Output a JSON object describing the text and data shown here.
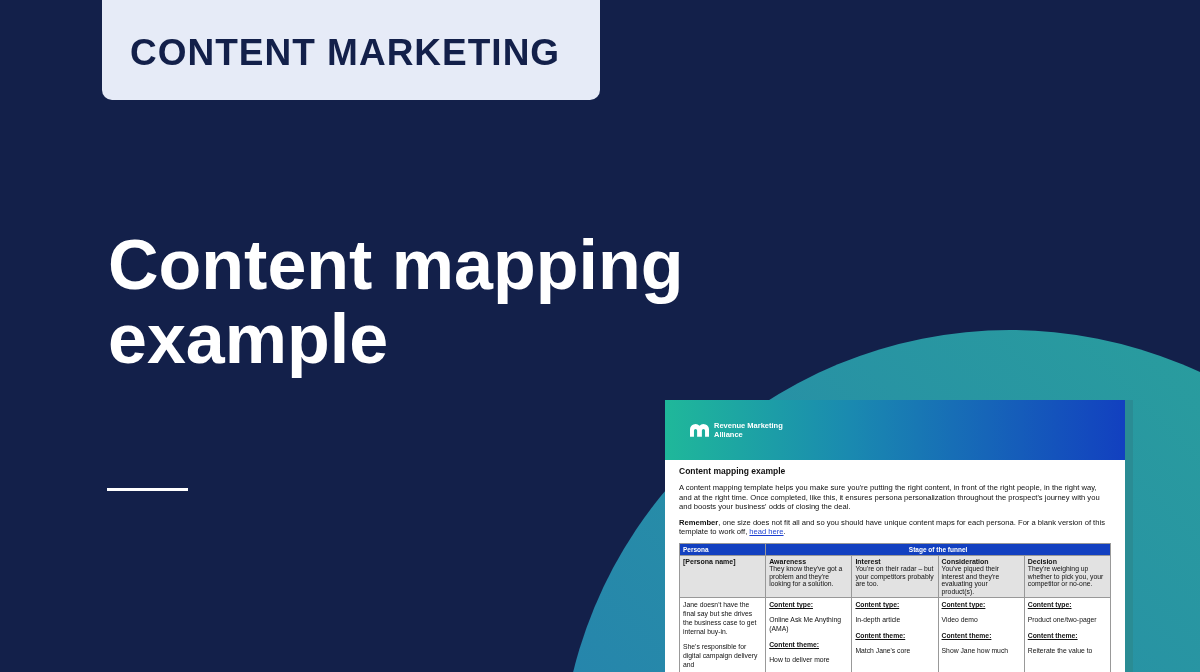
{
  "category": "CONTENT MARKETING",
  "title": "Content mapping example",
  "document": {
    "brand": "Revenue Marketing Alliance",
    "heading": "Content mapping example",
    "intro": "A content mapping template helps you make sure you're putting the right content, in front of the right people, in the right way, and at the right time. Once completed, like this, it ensures persona personalization throughout the prospect's journey with you and boosts your business' odds of closing the deal.",
    "note": "**Remember**, one size does not fit all and so you should have unique content maps for each persona. For a blank version of this template to work off,",
    "note_link": "head here",
    "note_end": ".",
    "table": {
      "persona_header": "Persona",
      "stage_header": "Stage of the funnel",
      "persona_name": "[Persona name]",
      "persona_text": [
        "Jane doesn't have the final say but she drives the business case to get internal buy-in.",
        "She's responsible for digital campaign delivery and"
      ],
      "stages": [
        {
          "name": "Awareness",
          "description": "They know they've got a problem and they're looking for a solution.",
          "type_label": "Content type:",
          "type": "Online Ask Me Anything (AMA)",
          "theme_label": "Content theme:",
          "theme": "How to deliver more"
        },
        {
          "name": "Interest",
          "description": "You're on their radar – but your competitors probably are too.",
          "type_label": "Content type:",
          "type": "In-depth article",
          "theme_label": "Content theme:",
          "theme": "Match Jane's core"
        },
        {
          "name": "Consideration",
          "description": "You've piqued their interest and they're evaluating your product(s).",
          "type_label": "Content type:",
          "type": "Video demo",
          "theme_label": "Content theme:",
          "theme": "Show Jane how much"
        },
        {
          "name": "Decision",
          "description": "They're weighing up whether to pick you, your competitor or no-one.",
          "type_label": "Content type:",
          "type": "Product one/two-pager",
          "theme_label": "Content theme:",
          "theme": "Reiterate the value to"
        }
      ]
    }
  }
}
